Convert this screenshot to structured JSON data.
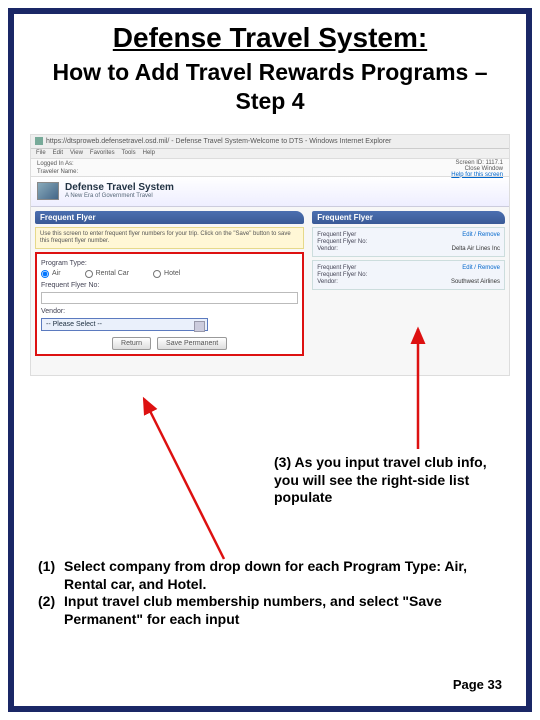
{
  "title1": "Defense Travel System:",
  "title2": "How to Add Travel Rewards Programs – Step 4",
  "browser": {
    "url": "https://dtsproweb.defensetravel.osd.mil/ - Defense Travel System-Welcome to DTS - Windows Internet Explorer",
    "menus": [
      "File",
      "Edit",
      "View",
      "Favorites",
      "Tools",
      "Help"
    ],
    "loggedInLabel": "Logged In As:",
    "travelerLabel": "Traveler Name:",
    "screenId": "Screen ID: 1117.1",
    "closeWindow": "Close Window",
    "helpLink": "Help for this screen"
  },
  "brand": {
    "title": "Defense Travel System",
    "sub": "A New Era of Government Travel"
  },
  "leftPanel": {
    "header": "Frequent Flyer",
    "hint": "Use this screen to enter frequent flyer numbers for your trip. Click on the \"Save\" button to save this frequent flyer number.",
    "programTypeLabel": "Program Type:",
    "radios": {
      "air": "Air",
      "rental": "Rental Car",
      "hotel": "Hotel"
    },
    "ffNoLabel": "Frequent Flyer No:",
    "vendorLabel": "Vendor:",
    "dropdownPlaceholder": "-- Please Select --",
    "buttons": {
      "return": "Return",
      "save": "Save Permanent"
    }
  },
  "rightPanel": {
    "header": "Frequent Flyer",
    "entry1": {
      "ffLabel": "Frequent Flyer",
      "edit": "Edit / Remove",
      "ffNoLabel": "Frequent Flyer No:",
      "vendorLabel": "Vendor:",
      "vendor": "Delta Air Lines Inc"
    },
    "entry2": {
      "ffLabel": "Frequent Flyer",
      "edit": "Edit / Remove",
      "ffNoLabel": "Frequent Flyer No:",
      "vendorLabel": "Vendor:",
      "vendor": "Southwest Airlines"
    }
  },
  "caption": "(3) As you input travel club info, you will see the right-side list populate",
  "steps": {
    "s1num": "(1)",
    "s1": "Select company from drop down for each Program Type: Air, Rental car, and Hotel.",
    "s2num": "(2)",
    "s2": "Input travel club membership numbers, and select \"Save Permanent\" for each input"
  },
  "pageNum": "Page 33"
}
